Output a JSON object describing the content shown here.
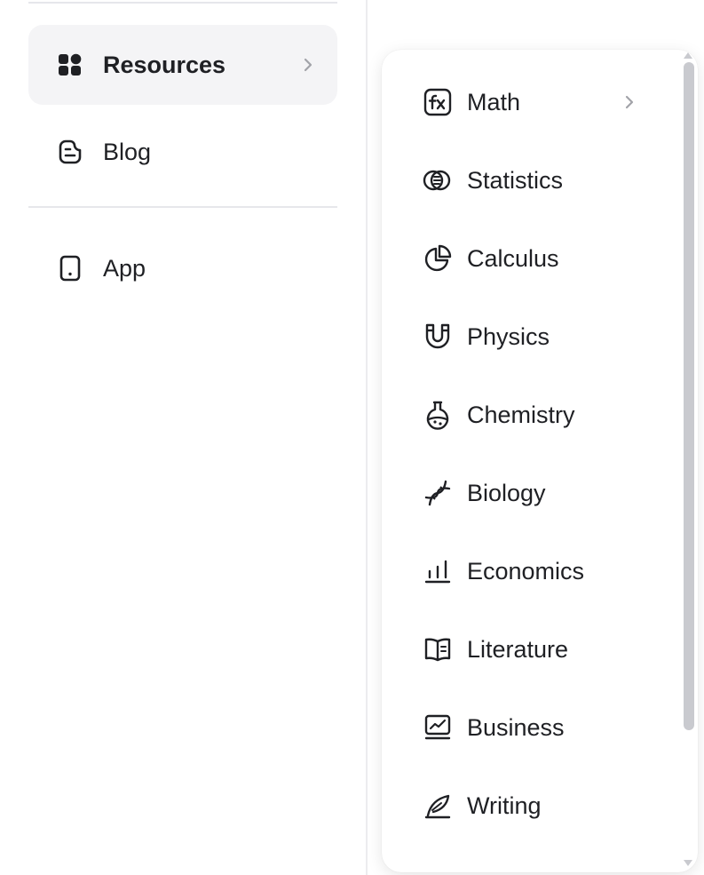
{
  "nav": {
    "resources_label": "Resources",
    "blog_label": "Blog",
    "app_label": "App"
  },
  "submenu": {
    "items": [
      {
        "label": "Math",
        "icon": "function-icon",
        "has_submenu": true
      },
      {
        "label": "Statistics",
        "icon": "coins-icon"
      },
      {
        "label": "Calculus",
        "icon": "pie-chart-icon"
      },
      {
        "label": "Physics",
        "icon": "magnet-icon"
      },
      {
        "label": "Chemistry",
        "icon": "flask-icon"
      },
      {
        "label": "Biology",
        "icon": "dna-icon"
      },
      {
        "label": "Economics",
        "icon": "bar-chart-icon"
      },
      {
        "label": "Literature",
        "icon": "book-icon"
      },
      {
        "label": "Business",
        "icon": "presentation-chart-icon"
      },
      {
        "label": "Writing",
        "icon": "feather-icon"
      }
    ]
  },
  "colors": {
    "text": "#1f2024",
    "active_bg": "#f4f4f6",
    "divider": "#e6e7eb",
    "chevron": "#a2a3a9",
    "scrollbar": "#c9cacf"
  }
}
